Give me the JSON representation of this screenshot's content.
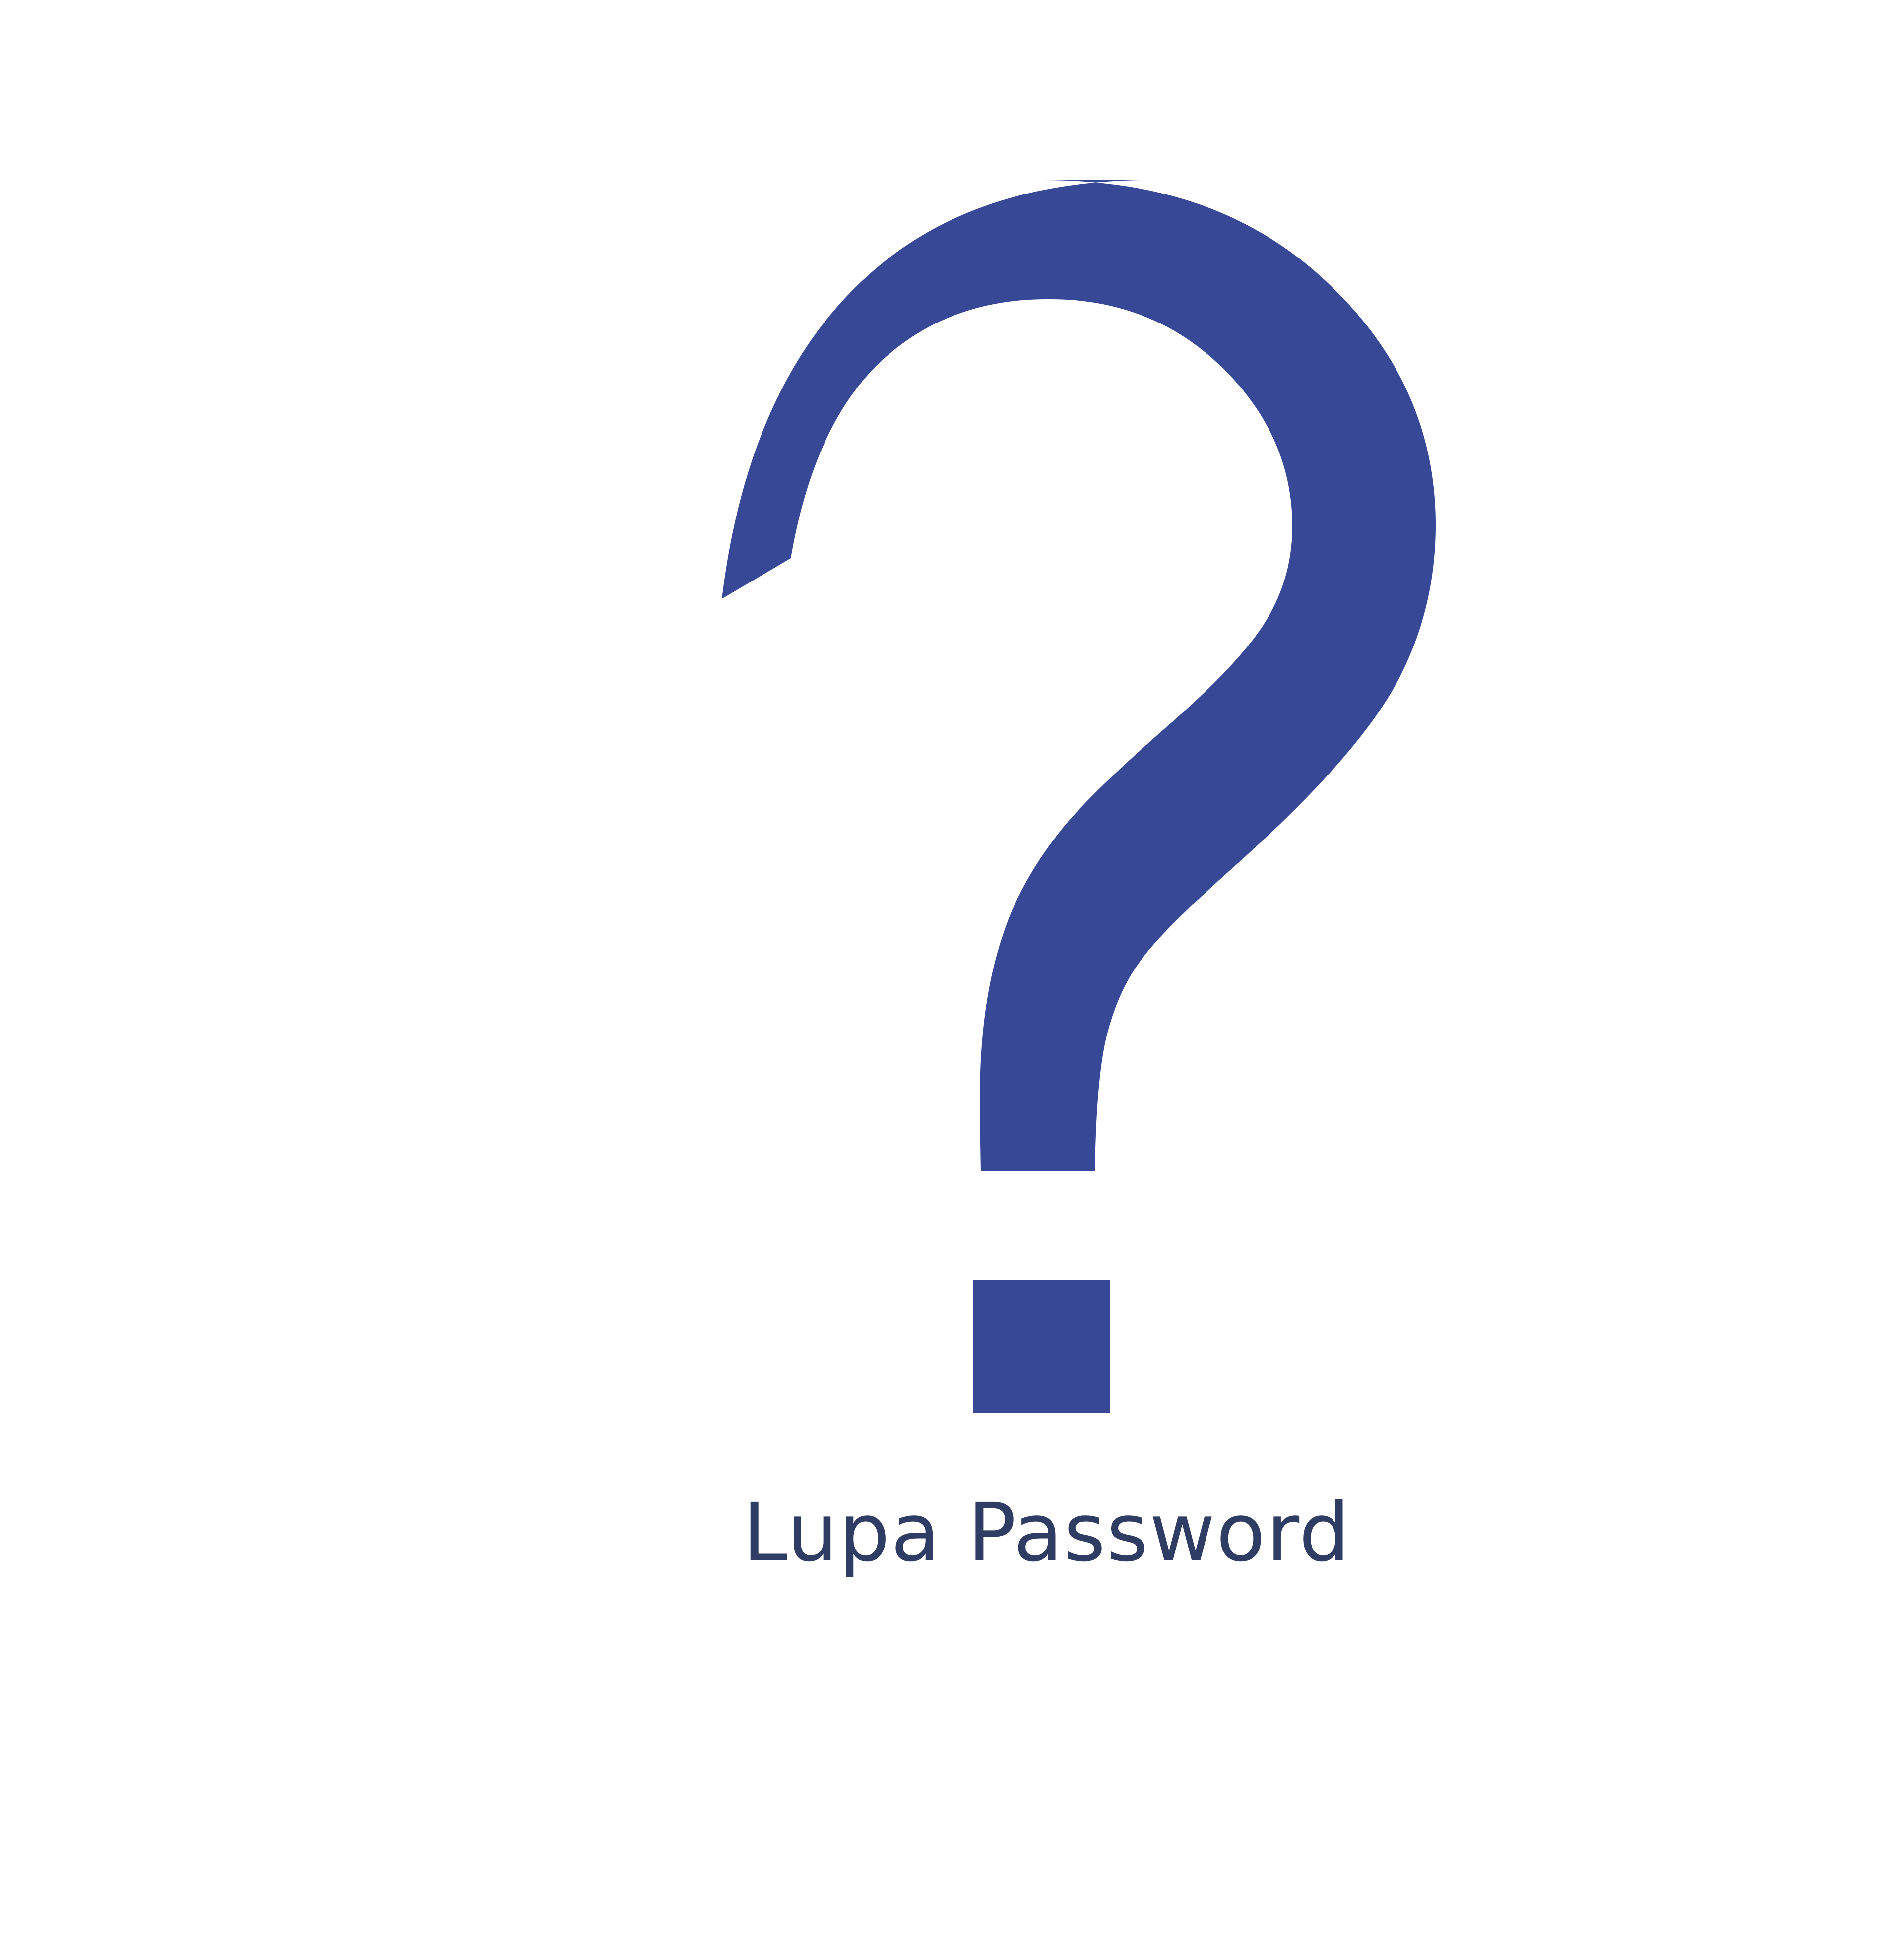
{
  "icon": {
    "name": "question-mark-icon",
    "color": "#374897"
  },
  "caption": {
    "text": "Lupa Password",
    "color": "#2f3c63"
  },
  "background": "#ffffff"
}
